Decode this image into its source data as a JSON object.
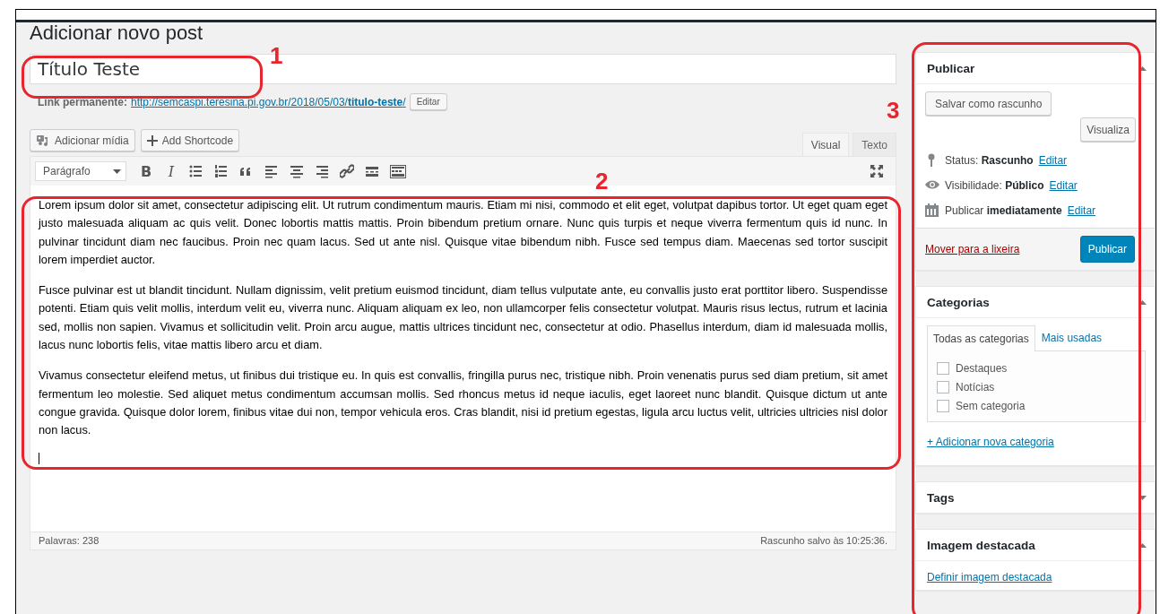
{
  "page_title": "Adicionar novo post",
  "post_title": {
    "value": "Título Teste"
  },
  "permalink": {
    "label": "Link permanente:",
    "url_base": "http://semcaspi.teresina.pi.gov.br/2018/05/03/",
    "slug": "titulo-teste",
    "url_end": "/",
    "edit_button": "Editar"
  },
  "media_buttons": [
    {
      "kind": "media",
      "label": "Adicionar mídia"
    },
    {
      "kind": "plus",
      "label": "Add Shortcode"
    }
  ],
  "editor_tabs": [
    {
      "label": "Visual",
      "selected": true
    },
    {
      "label": "Texto",
      "selected": false
    }
  ],
  "toolbar": {
    "format_select": "Parágrafo",
    "text_buttons": [
      "B",
      "I"
    ]
  },
  "paragraphs": [
    "Lorem ipsum dolor sit amet, consectetur adipiscing elit. Ut rutrum condimentum mauris. Etiam mi nisi, commodo et elit eget, volutpat dapibus tortor. Ut eget quam eget justo malesuada aliquam ac quis velit. Donec lobortis mattis mattis. Proin bibendum pretium ornare. Nunc quis turpis et neque viverra fermentum quis id nunc. In pulvinar tincidunt diam nec faucibus. Proin nec quam lacus. Sed ut ante nisl. Quisque vitae bibendum nibh. Fusce sed tempus diam. Maecenas sed tortor suscipit lorem imperdiet auctor.",
    "Fusce pulvinar est ut blandit tincidunt. Nullam dignissim, velit pretium euismod tincidunt, diam tellus vulputate ante, eu convallis justo erat porttitor libero. Suspendisse potenti. Etiam quis velit mollis, interdum velit eu, viverra nunc. Aliquam aliquam ex leo, non ullamcorper felis consectetur volutpat. Mauris risus lectus, rutrum et lacinia sed, mollis non sapien. Vivamus et sollicitudin velit. Proin arcu augue, mattis ultrices tincidunt nec, consectetur at odio. Phasellus interdum, diam id malesuada mollis, lacus nunc lobortis felis, vitae mattis libero arcu et diam.",
    "Vivamus consectetur eleifend metus, ut finibus dui tristique eu. In quis est convallis, fringilla purus nec, tristique nibh. Proin venenatis purus sed diam pretium, sit amet fermentum leo molestie. Sed aliquet metus condimentum accumsan mollis. Sed rhoncus metus id neque iaculis, eget laoreet nunc blandit. Quisque dictum ut ante congue gravida. Quisque dolor lorem, finibus vitae dui non, tempor vehicula eros. Cras blandit, nisi id pretium egestas, ligula arcu luctus velit, ultricies ultricies nisl dolor non lacus."
  ],
  "status_bar": {
    "word_count": "Palavras: 238",
    "saved": "Rascunho salvo às 10:25:36."
  },
  "publish_box": {
    "title": "Publicar",
    "expanded": true,
    "save_draft": "Salvar como rascunho",
    "preview": "Visualiza",
    "rows": [
      {
        "kind": "pin",
        "label": "Status:",
        "value": "Rascunho",
        "link": "Editar"
      },
      {
        "kind": "eye",
        "label": "Visibilidade:",
        "value": "Público",
        "link": "Editar"
      },
      {
        "kind": "calendar",
        "label": "Publicar",
        "value": "imediatamente",
        "link": "Editar"
      }
    ],
    "trash_link": "Mover para a lixeira",
    "publish_button": "Publicar"
  },
  "categories_box": {
    "title": "Categorias",
    "expanded": true,
    "tabs": [
      {
        "label": "Todas as categorias",
        "selected": true
      },
      {
        "label": "Mais usadas",
        "selected": false
      }
    ],
    "items": [
      {
        "label": "Destaques",
        "checked": false
      },
      {
        "label": "Notícias",
        "checked": false
      },
      {
        "label": "Sem categoria",
        "checked": false
      }
    ],
    "add_link": "+ Adicionar nova categoria"
  },
  "tags_box": {
    "title": "Tags",
    "expanded": false
  },
  "featured_image_box": {
    "title": "Imagem destacada",
    "expanded": true,
    "link": "Definir imagem destacada"
  },
  "annotations": [
    {
      "label": "1"
    },
    {
      "label": "2"
    },
    {
      "label": "3"
    }
  ]
}
